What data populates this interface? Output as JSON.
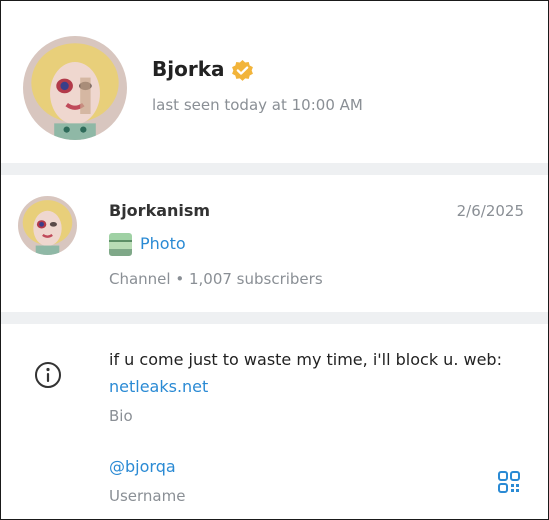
{
  "profile": {
    "name": "Bjorka",
    "status": "last seen today at 10:00 AM",
    "avatar_icon": "profile-avatar",
    "verified_icon": "verified-badge-icon"
  },
  "channel": {
    "name": "Bjorkanism",
    "date": "2/6/2025",
    "last_message": "Photo",
    "meta": "Channel • 1,007 subscribers"
  },
  "info": {
    "bio_text": "if u come just to waste my time, i'll block u. web:",
    "bio_link": "netleaks.net",
    "bio_label": "Bio",
    "username": "@bjorqa",
    "username_label": "Username"
  },
  "colors": {
    "accent": "#2a8ad4",
    "muted": "#8a8f95",
    "divider": "#eef0f2",
    "verified": "#f2b43a"
  }
}
